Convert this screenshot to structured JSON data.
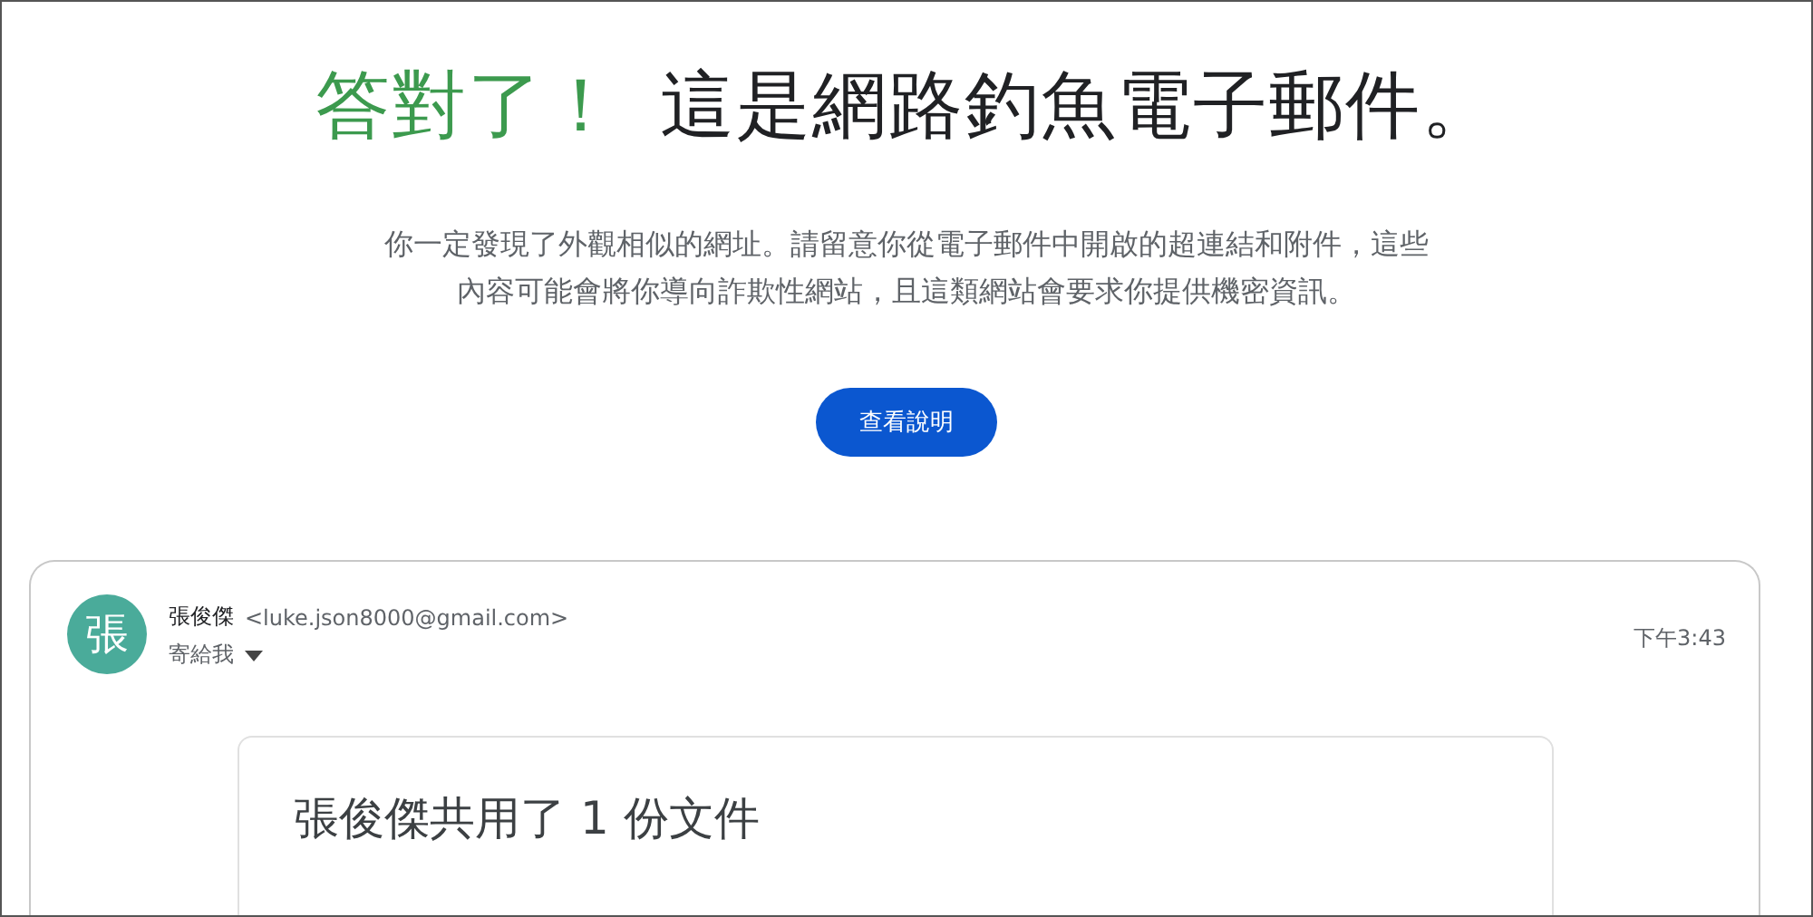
{
  "heading": {
    "highlight": "答對了！",
    "text": "這是網路釣魚電子郵件。"
  },
  "description": "你一定發現了外觀相似的網址。請留意你從電子郵件中開啟的超連結和附件，這些內容可能會將你導向詐欺性網站，且這類網站會要求你提供機密資訊。",
  "help_button": "查看說明",
  "email": {
    "avatar": "張",
    "sender_name": "張俊傑",
    "sender_address": "<luke.json8000@gmail.com>",
    "recipient": "寄給我",
    "time": "下午3:43",
    "body_title": "張俊傑共用了 1 份文件"
  }
}
